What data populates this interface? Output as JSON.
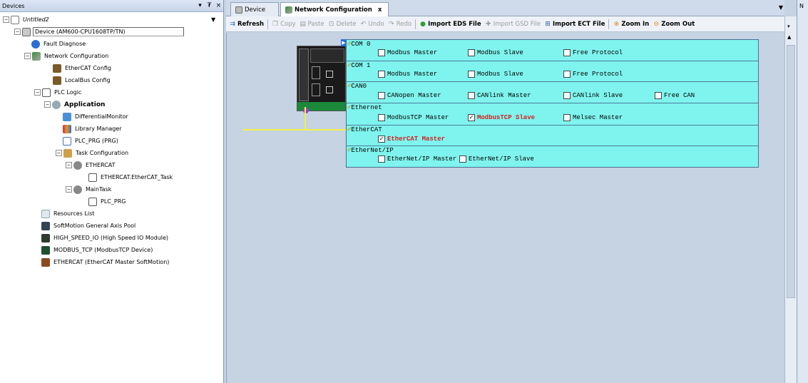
{
  "devices_panel": {
    "title": "Devices",
    "pin": "▾",
    "pin2": "₮",
    "close": "×"
  },
  "tree": [
    {
      "label": "Untitled2",
      "italic": true
    },
    {
      "label": "Device (AM600-CPU1608TP/TN)"
    },
    {
      "label": "Fault Diagnose"
    },
    {
      "label": "Network Configuration"
    },
    {
      "label": "EtherCAT Config"
    },
    {
      "label": "LocalBus Config"
    },
    {
      "label": "PLC Logic"
    },
    {
      "label": "Application",
      "bold": true
    },
    {
      "label": "DifferentialMonitor"
    },
    {
      "label": "Library Manager"
    },
    {
      "label": "PLC_PRG (PRG)"
    },
    {
      "label": "Task Configuration"
    },
    {
      "label": "ETHERCAT"
    },
    {
      "label": "ETHERCAT.EtherCAT_Task"
    },
    {
      "label": "MainTask"
    },
    {
      "label": "PLC_PRG"
    },
    {
      "label": "Resources List"
    },
    {
      "label": "SoftMotion General Axis Pool"
    },
    {
      "label": "HIGH_SPEED_IO (High Speed IO Module)"
    },
    {
      "label": "MODBUS_TCP (ModbusTCP Device)"
    },
    {
      "label": "ETHERCAT (EtherCAT Master SoftMotion)"
    }
  ],
  "tabs": [
    {
      "label": "Device"
    },
    {
      "label": "Network Configuration",
      "close": "x"
    }
  ],
  "toolbar": {
    "refresh": "Refresh",
    "copy": "Copy",
    "paste": "Paste",
    "delete": "Delete",
    "undo": "Undo",
    "redo": "Redo",
    "import_eds": "Import EDS File",
    "import_gsd": "Import GSD File",
    "import_ect": "Import ECT File",
    "zoom_in": "Zoom In",
    "zoom_out": "Zoom Out"
  },
  "right_panel": {
    "label": "N"
  },
  "network": [
    {
      "name": "COM 0",
      "options": [
        {
          "label": "Modbus Master",
          "checked": false
        },
        {
          "label": "Modbus Slave",
          "checked": false
        },
        {
          "label": "Free Protocol",
          "checked": false
        }
      ]
    },
    {
      "name": "COM 1",
      "options": [
        {
          "label": "Modbus Master",
          "checked": false
        },
        {
          "label": "Modbus Slave",
          "checked": false
        },
        {
          "label": "Free Protocol",
          "checked": false
        }
      ]
    },
    {
      "name": "CAN0",
      "options": [
        {
          "label": "CANopen Master",
          "checked": false
        },
        {
          "label": "CANlink Master",
          "checked": false
        },
        {
          "label": "CANlink Slave",
          "checked": false
        },
        {
          "label": "Free CAN",
          "checked": false
        }
      ]
    },
    {
      "name": "Ethernet",
      "options": [
        {
          "label": "ModbusTCP Master",
          "checked": false
        },
        {
          "label": "ModbusTCP Slave",
          "checked": true
        },
        {
          "label": "Melsec Master",
          "checked": false
        }
      ]
    },
    {
      "name": "EtherCAT",
      "options": [
        {
          "label": "EtherCAT Master",
          "checked": true
        }
      ]
    },
    {
      "name": "EtherNet/IP",
      "options": [
        {
          "label": "EtherNet/IP Master",
          "checked": false
        },
        {
          "label": "EtherNet/IP Slave",
          "checked": false
        }
      ]
    }
  ],
  "colors": {
    "accent_checked": "#d31e1e",
    "panel_bg": "#7ff4ee",
    "canvas_bg": "#c5d3e2",
    "wire": "#f2f046"
  }
}
